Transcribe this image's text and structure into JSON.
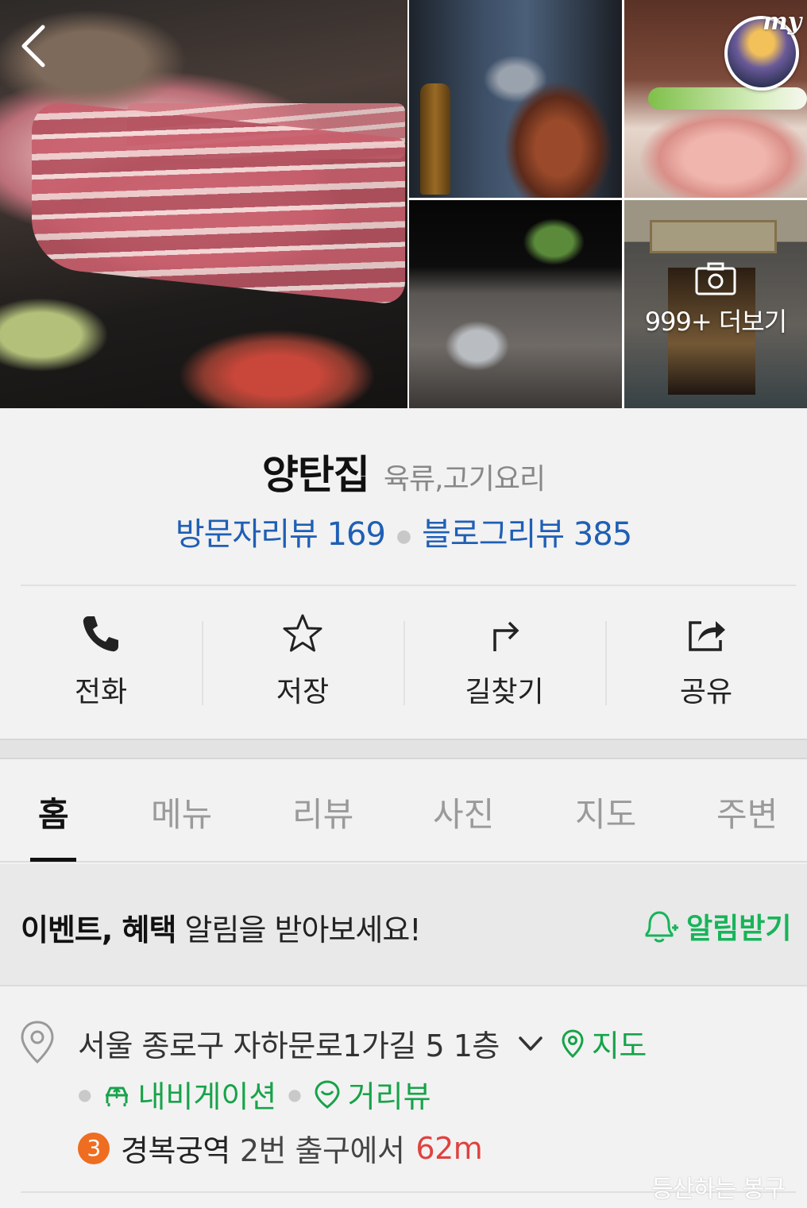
{
  "place": {
    "name": "양탄집",
    "category": "육류,고기요리",
    "visitor_review_label": "방문자리뷰 169",
    "blog_review_label": "블로그리뷰 385"
  },
  "gallery": {
    "more_label": "999+ 더보기",
    "avatar_badge": "my"
  },
  "actions": [
    {
      "label": "전화",
      "icon": "phone-icon"
    },
    {
      "label": "저장",
      "icon": "star-icon"
    },
    {
      "label": "길찾기",
      "icon": "directions-icon"
    },
    {
      "label": "공유",
      "icon": "share-icon"
    }
  ],
  "tabs": [
    "홈",
    "메뉴",
    "리뷰",
    "사진",
    "지도",
    "주변"
  ],
  "active_tab": "홈",
  "notice": {
    "bold_text": "이벤트, 혜택",
    "text": " 알림을 받아보세요!",
    "button_label": "알림받기"
  },
  "address": {
    "text": "서울 종로구 자하문로1가길 5 1층",
    "map_label": "지도",
    "navigation_label": "내비게이션",
    "streetview_label": "거리뷰",
    "subway_line": "3",
    "subway_line_color": "#ee6d20",
    "station": "경복궁역",
    "exit_text": "2번 출구에서",
    "distance": "62m"
  },
  "watermark": "등산하는 봉구",
  "colors": {
    "link_blue": "#1f5fb5",
    "accent_green": "#17a34a",
    "distance_red": "#e0413f"
  }
}
